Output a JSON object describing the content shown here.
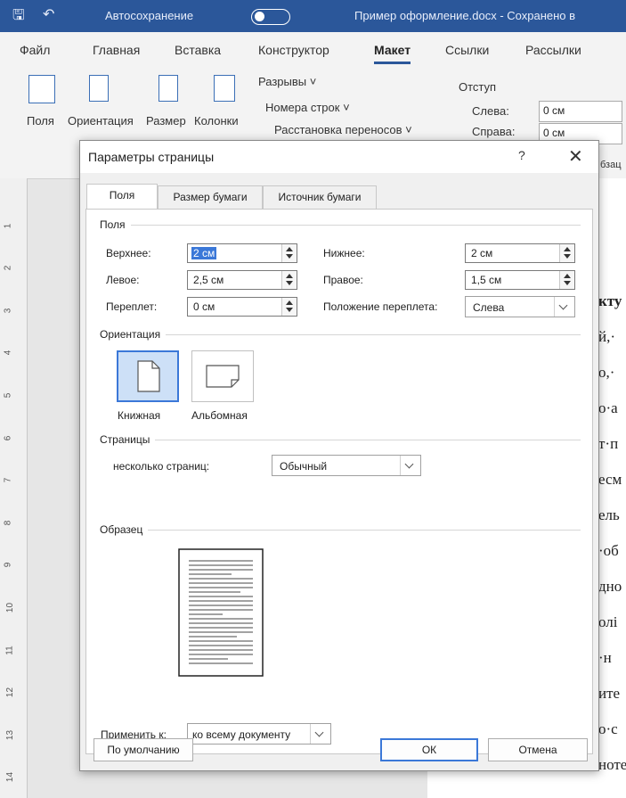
{
  "titlebar": {
    "autosave": "Автосохранение",
    "doc_title": "Пример оформление.docx - Сохранено в"
  },
  "menu": [
    "Файл",
    "Главная",
    "Вставка",
    "Конструктор",
    "Макет",
    "Ссылки",
    "Рассылки"
  ],
  "ribbon": {
    "fields": "Поля",
    "orientation": "Ориентация",
    "size": "Размер",
    "columns": "Колонки",
    "breaks": "Разрывы ˅",
    "line_numbers": "Номера строк ˅",
    "hyphenation": "Расстановка переносов ˅",
    "indent": "Отступ",
    "left": "Слева:",
    "left_value": "0 см",
    "right": "Справа:",
    "right_value": "0 см",
    "paragraph": "бзац"
  },
  "document_lines": [
    "кту",
    "й,·",
    "о,·",
    "о·а",
    "т·п",
    "есм",
    "ель",
    "·об",
    "дно",
    "олі",
    "·н",
    "ите",
    "о·с",
    "ноте"
  ],
  "dialog": {
    "title": "Параметры страницы",
    "help": "?",
    "close": "✕",
    "tabs": [
      "Поля",
      "Размер бумаги",
      "Источник бумаги"
    ],
    "margins_group": "Поля",
    "top_label": "Верхнее:",
    "top_value": "2 см",
    "bottom_label": "Нижнее:",
    "bottom_value": "2 см",
    "left_label": "Левое:",
    "left_value": "2,5 см",
    "right_label": "Правое:",
    "right_value": "1,5 см",
    "gutter_label": "Переплет:",
    "gutter_value": "0 см",
    "gutter_pos_label": "Положение переплета:",
    "gutter_pos_value": "Слева",
    "orientation_group": "Ориентация",
    "portrait": "Книжная",
    "landscape": "Альбомная",
    "pages_group": "Страницы",
    "multiple_pages_label": "несколько страниц:",
    "multiple_pages_value": "Обычный",
    "preview_group": "Образец",
    "apply_label": "Применить к:",
    "apply_value": "ко всему документу",
    "default_button": "По умолчанию",
    "ok_button": "ОК",
    "cancel_button": "Отмена"
  }
}
